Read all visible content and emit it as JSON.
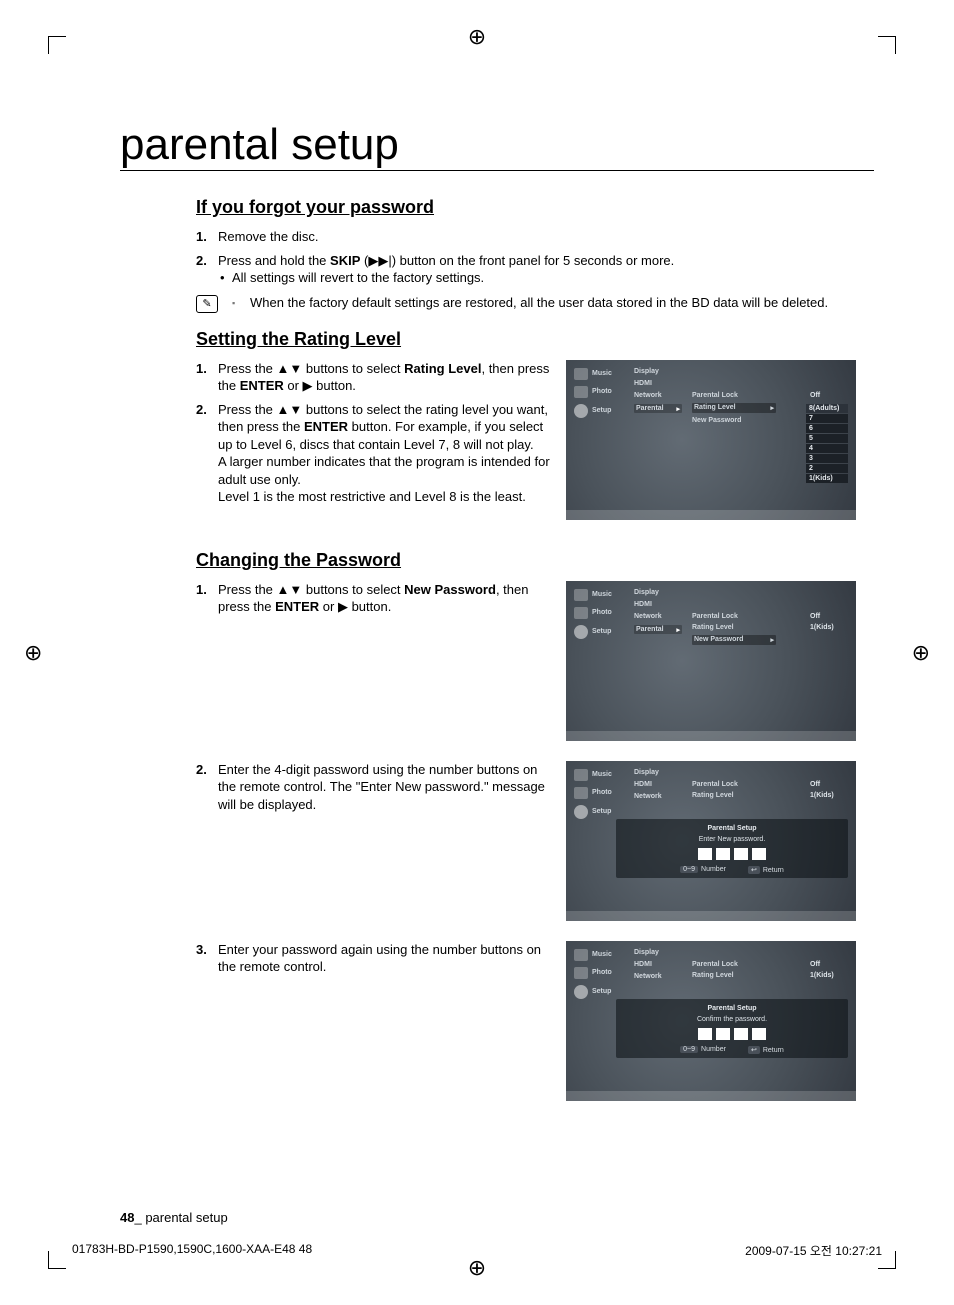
{
  "title": "parental setup",
  "s1": {
    "heading": "If you forgot your password",
    "step1": {
      "num": "1.",
      "text": "Remove the disc."
    },
    "step2": {
      "num": "2.",
      "p1_a": "Press and hold the ",
      "p1_b": "SKIP",
      "p1_c": " (",
      "p1_icon": "▶▶|",
      "p1_d": ") button on the front panel for 5 seconds or more.",
      "bullet": "All settings will revert to the factory settings."
    },
    "note": "When the factory default settings are restored, all the user data stored in the BD data will be deleted."
  },
  "s2": {
    "heading": "Setting the Rating Level",
    "step1": {
      "num": "1.",
      "a": "Press the ",
      "icons": "▲▼",
      "b": " buttons to select ",
      "bold": "Rating Level",
      "c": ", then press the ",
      "bold2": "ENTER",
      "d": " or ",
      "icon2": "▶",
      "e": " button."
    },
    "step2": {
      "num": "2.",
      "a": "Press the ",
      "icons": "▲▼",
      "b": " buttons to select the rating level you want, then press the ",
      "bold": "ENTER",
      "c": " button. For example, if you select up to Level 6, discs that contain Level 7, 8 will not play.",
      "more1": "A larger number indicates that the program is intended for adult use only.",
      "more2": "Level 1 is the most restrictive and Level 8 is the least."
    }
  },
  "s3": {
    "heading": "Changing the Password",
    "step1": {
      "num": "1.",
      "a": "Press the ",
      "icons": "▲▼",
      "b": " buttons to select ",
      "bold": "New Password",
      "c": ", then press the ",
      "bold2": "ENTER",
      "d": " or ",
      "icon2": "▶",
      "e": " button."
    },
    "step2": {
      "num": "2.",
      "text": "Enter the 4-digit password using the number buttons on the remote control. The \"Enter New password.\" message will be displayed."
    },
    "step3": {
      "num": "3.",
      "text": "Enter your password again using the number buttons on the remote control."
    }
  },
  "ui": {
    "nav": {
      "music": "Music",
      "photo": "Photo",
      "setup": "Setup"
    },
    "mid": {
      "display": "Display",
      "hdmi": "HDMI",
      "network": "Network",
      "parental": "Parental"
    },
    "opts": {
      "parental_lock": "Parental Lock",
      "rating_level": "Rating Level",
      "new_password": "New Password"
    },
    "vals": {
      "off": "Off",
      "one_kids": "1(Kids)"
    },
    "drop": [
      "8(Adults)",
      "7",
      "6",
      "5",
      "4",
      "3",
      "2",
      "1(Kids)"
    ],
    "dialog": {
      "title": "Parental Setup",
      "enter": "Enter New password.",
      "confirm": "Confirm the password.",
      "hint_num_k": "0~9",
      "hint_num": "Number",
      "hint_ret_k": "↩",
      "hint_ret": "Return"
    }
  },
  "footer": {
    "pnum": "48",
    "sep": "_ ",
    "label": "parental setup"
  },
  "meta": {
    "left": "01783H-BD-P1590,1590C,1600-XAA-E48   48",
    "right": "2009-07-15   오전 10:27:21"
  }
}
